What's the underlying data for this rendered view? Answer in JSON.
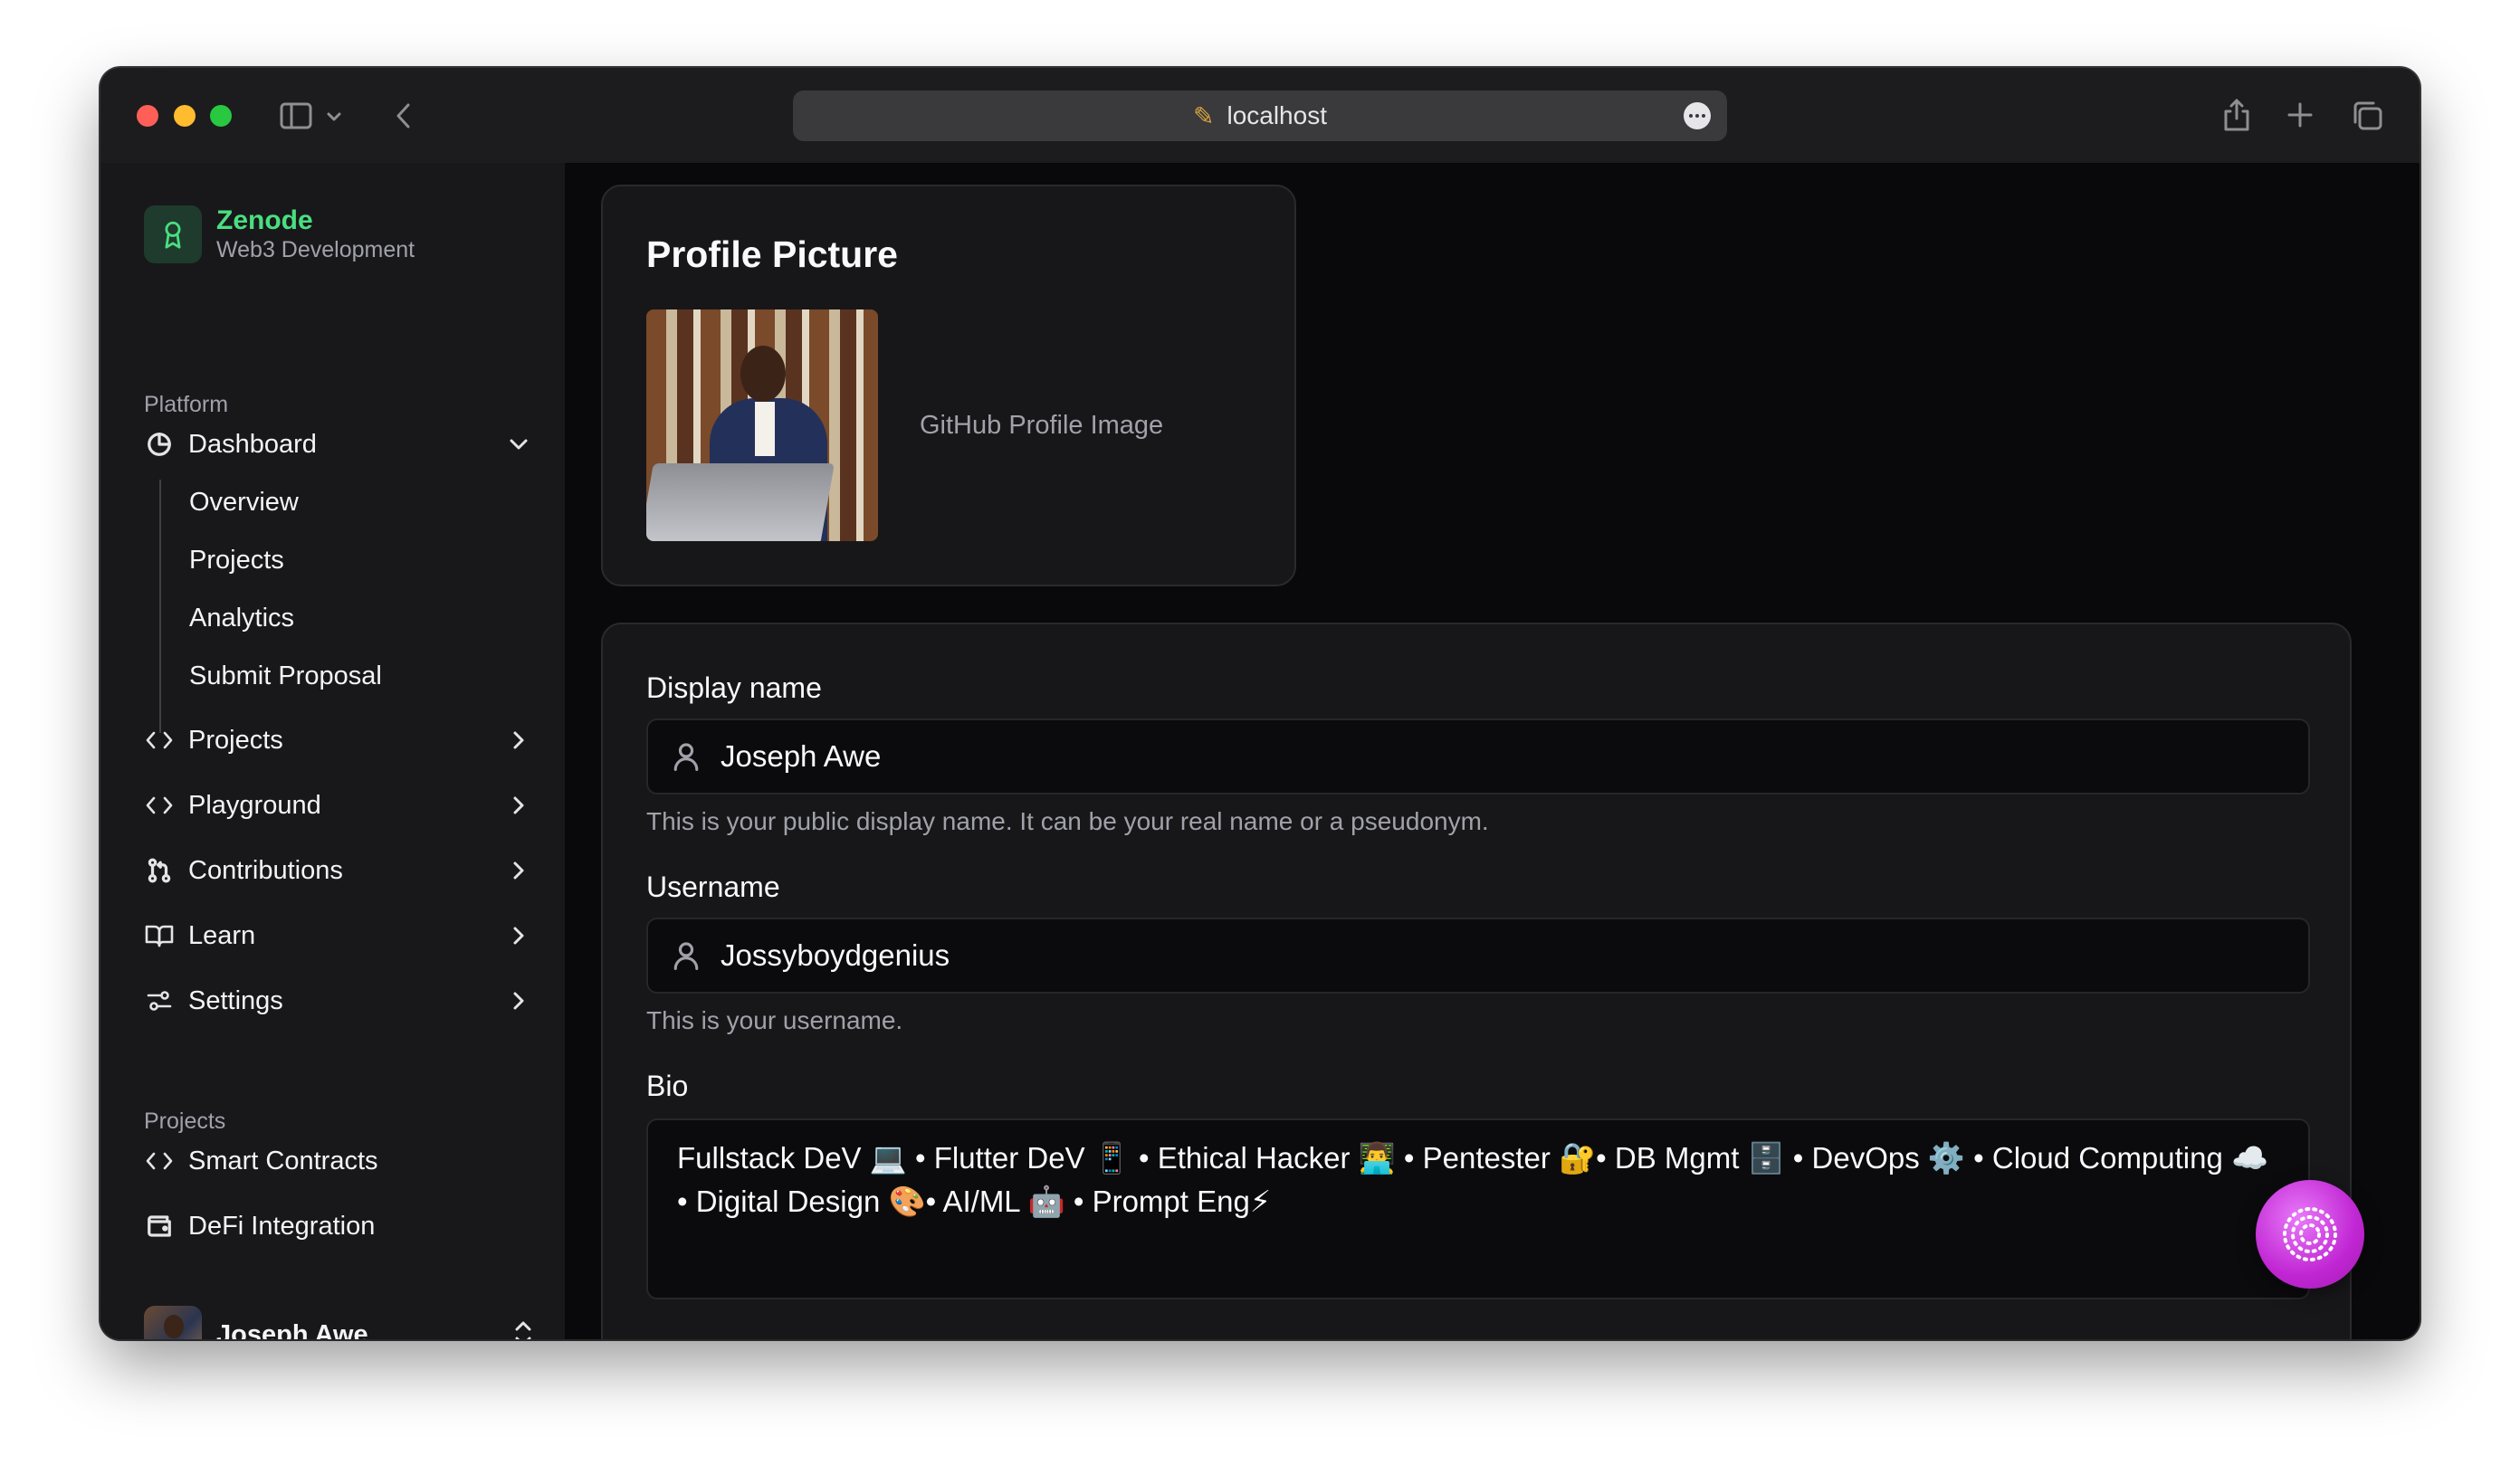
{
  "browser": {
    "url": "localhost",
    "icons": [
      "sidebar-toggle-icon",
      "chevron-down-icon",
      "back-icon",
      "more-icon",
      "share-icon",
      "new-tab-icon",
      "tab-overview-icon"
    ]
  },
  "sidebar": {
    "brand": {
      "name": "Zenode",
      "subtitle": "Web3 Development"
    },
    "platform_label": "Platform",
    "dashboard": {
      "label": "Dashboard",
      "children": [
        "Overview",
        "Projects",
        "Analytics",
        "Submit Proposal"
      ]
    },
    "items": [
      {
        "label": "Projects",
        "icon": "code-icon"
      },
      {
        "label": "Playground",
        "icon": "code-icon"
      },
      {
        "label": "Contributions",
        "icon": "git-pull-request-icon"
      },
      {
        "label": "Learn",
        "icon": "book-icon"
      },
      {
        "label": "Settings",
        "icon": "settings-sliders-icon"
      }
    ],
    "projects_label": "Projects",
    "projects": [
      {
        "label": "Smart Contracts",
        "icon": "code-icon"
      },
      {
        "label": "DeFi Integration",
        "icon": "wallet-icon"
      }
    ],
    "user": {
      "name": "Joseph Awe"
    }
  },
  "profile_picture": {
    "title": "Profile Picture",
    "caption": "GitHub Profile Image"
  },
  "form": {
    "display_name": {
      "label": "Display name",
      "value": "Joseph Awe",
      "help": "This is your public display name. It can be your real name or a pseudonym."
    },
    "username": {
      "label": "Username",
      "value": "Jossyboydgenius",
      "help": "This is your username."
    },
    "bio": {
      "label": "Bio",
      "value": "Fullstack DeV 💻 • Flutter DeV 📱 • Ethical Hacker 👨‍💻 • Pentester 🔐• DB Mgmt 🗄️ • DevOps ⚙️ • Cloud Computing ☁️ • Digital Design 🎨• AI/ML 🤖 • Prompt Eng⚡"
    }
  },
  "colors": {
    "accent": "#4ade80",
    "fab": "#d946ef",
    "background": "#09090b",
    "sidebar": "#18181b"
  }
}
